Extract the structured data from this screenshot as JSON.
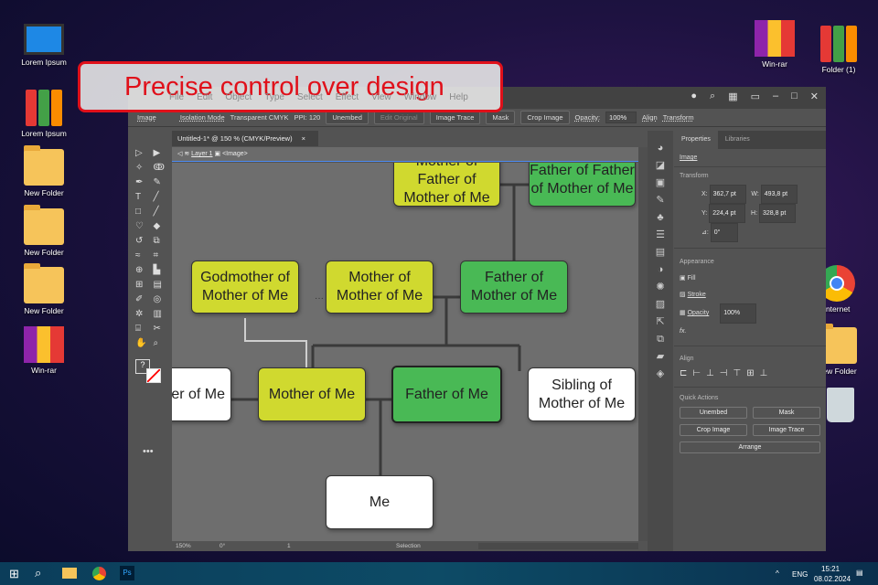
{
  "banner": "Precise control over design",
  "desktop_icons": {
    "left": [
      "Lorem Ipsum",
      "Lorem Ipsum",
      "New Folder",
      "New Folder",
      "New Folder",
      "Win-rar"
    ],
    "right": [
      "Win-rar",
      "Folder (1)",
      "Internet",
      "New Folder"
    ]
  },
  "menu": [
    "File",
    "Edit",
    "Object",
    "Type",
    "Select",
    "Effect",
    "View",
    "Window",
    "Help"
  ],
  "control_bar": {
    "image": "Image",
    "isolation": "Isolation Mode",
    "mode": "Transparent CMYK",
    "ppi": "PPI: 120",
    "unembed": "Unembed",
    "edit_original": "Edit Original",
    "image_trace": "Image Trace",
    "mask": "Mask",
    "crop": "Crop Image",
    "opacity_label": "Opacity:",
    "opacity": "100%",
    "align": "Align",
    "transform": "Transform"
  },
  "doc_tab": {
    "title": "Untitled-1* @ 150 % (CMYK/Preview)",
    "close": "×"
  },
  "breadcrumb": {
    "layer": "Layer 1",
    "object": "<Image>"
  },
  "nodes": {
    "mofome": "Mother of Father of Mother of Me",
    "fofome": "Father of Father of Mother of Me",
    "godmother": "Godmother of Mother of Me",
    "mome": "Mother of Mother of Me",
    "fome": "Father of Mother of Me",
    "partner": "ner of er of Me",
    "mother": "Mother of Me",
    "father": "Father of Me",
    "sibling": "Sibling of Mother of Me",
    "me": "Me"
  },
  "status": {
    "zoom": "150%",
    "angle": "0°",
    "page": "1",
    "tool": "Selection"
  },
  "panel": {
    "tabs": [
      "Properties",
      "Libraries"
    ],
    "kind": "Image",
    "transform": "Transform",
    "x": "362,7 pt",
    "y": "224,4 pt",
    "w": "493,8 pt",
    "h": "328,8 pt",
    "angle": "0°",
    "appearance": "Appearance",
    "fill": "Fill",
    "stroke": "Stroke",
    "opacity_label": "Opacity",
    "opacity": "100%",
    "fx": "fx.",
    "align": "Align",
    "quick_actions": "Quick Actions",
    "qa": [
      "Unembed",
      "Mask",
      "Crop Image",
      "Image Trace",
      "Arrange"
    ]
  },
  "taskbar": {
    "lang": "ENG",
    "time": "15:21",
    "date": "08.02.2024"
  }
}
